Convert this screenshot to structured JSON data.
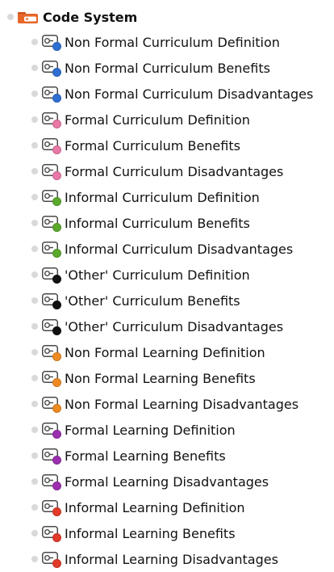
{
  "root": {
    "label": "Code System",
    "icon": "code-system-folder-icon",
    "color": "#e8662a"
  },
  "codes": [
    {
      "label": "Non Formal Curriculum Definition",
      "color": "#2f6fd1"
    },
    {
      "label": "Non Formal Curriculum Benefits",
      "color": "#2f6fd1"
    },
    {
      "label": "Non Formal Curriculum Disadvantages",
      "color": "#2f6fd1"
    },
    {
      "label": "Formal Curriculum Definition",
      "color": "#e878a6"
    },
    {
      "label": "Formal Curriculum Benefits",
      "color": "#e878a6"
    },
    {
      "label": "Formal Curriculum Disadvantages",
      "color": "#e878a6"
    },
    {
      "label": "Informal Curriculum Definition",
      "color": "#5aa82c"
    },
    {
      "label": "Informal Curriculum Benefits",
      "color": "#5aa82c"
    },
    {
      "label": "Informal Curriculum Disadvantages",
      "color": "#5aa82c"
    },
    {
      "label": "'Other' Curriculum Definition",
      "color": "#111111"
    },
    {
      "label": "'Other' Curriculum Benefits",
      "color": "#111111"
    },
    {
      "label": "'Other' Curriculum Disadvantages",
      "color": "#111111"
    },
    {
      "label": "Non Formal Learning Definition",
      "color": "#ee8a22"
    },
    {
      "label": "Non Formal Learning Benefits",
      "color": "#ee8a22"
    },
    {
      "label": "Non Formal Learning Disadvantages",
      "color": "#ee8a22"
    },
    {
      "label": "Formal Learning Definition",
      "color": "#9b2fae"
    },
    {
      "label": "Formal Learning Benefits",
      "color": "#9b2fae"
    },
    {
      "label": "Formal Learning Disadvantages",
      "color": "#9b2fae"
    },
    {
      "label": "Informal Learning Definition",
      "color": "#e23a2a"
    },
    {
      "label": "Informal Learning Benefits",
      "color": "#e23a2a"
    },
    {
      "label": "Informal Learning Disadvantages",
      "color": "#e23a2a"
    }
  ]
}
